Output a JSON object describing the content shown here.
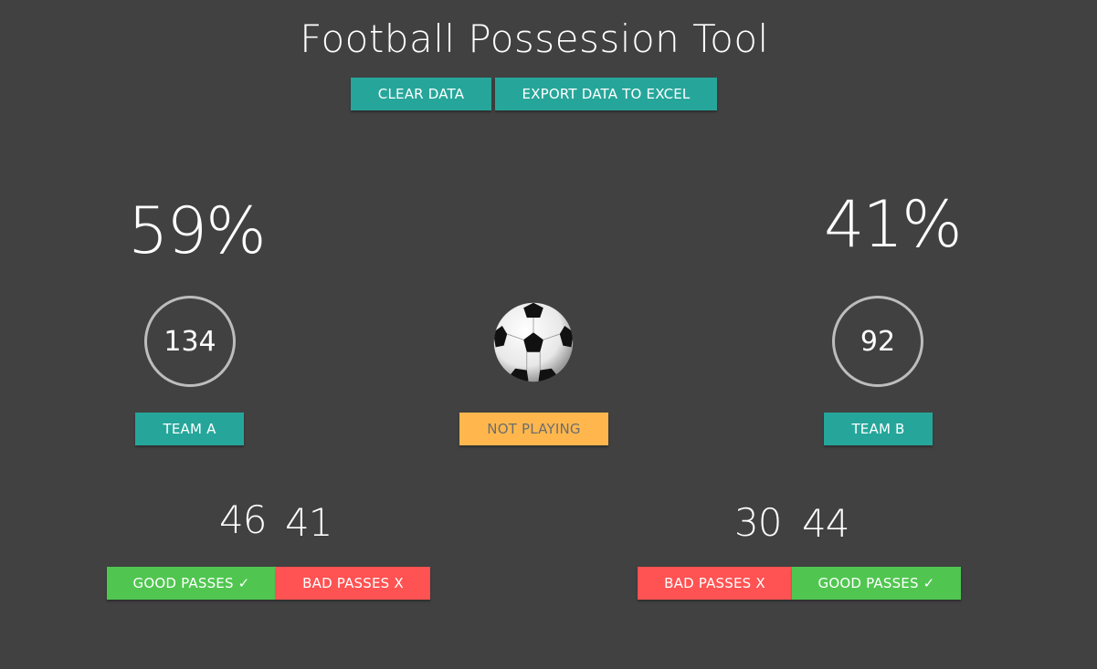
{
  "title": "Football Possession Tool",
  "toolbar": {
    "clear_label": "CLEAR DATA",
    "export_label": "EXPORT DATA TO EXCEL"
  },
  "team_a": {
    "possession_percent": "59%",
    "possession_count": "134",
    "button_label": "TEAM A",
    "good_passes": "46",
    "bad_passes": "41",
    "good_label": "GOOD PASSES ✓",
    "bad_label": "BAD PASSES X"
  },
  "team_b": {
    "possession_percent": "41%",
    "possession_count": "92",
    "button_label": "TEAM B",
    "bad_passes": "30",
    "good_passes": "44",
    "good_label": "GOOD PASSES ✓",
    "bad_label": "BAD PASSES X"
  },
  "status": {
    "label": "NOT PLAYING"
  },
  "colors": {
    "background": "#414141",
    "teal": "#26a69a",
    "orange": "#ffb74d",
    "green": "#50c650",
    "red": "#ff5252"
  }
}
